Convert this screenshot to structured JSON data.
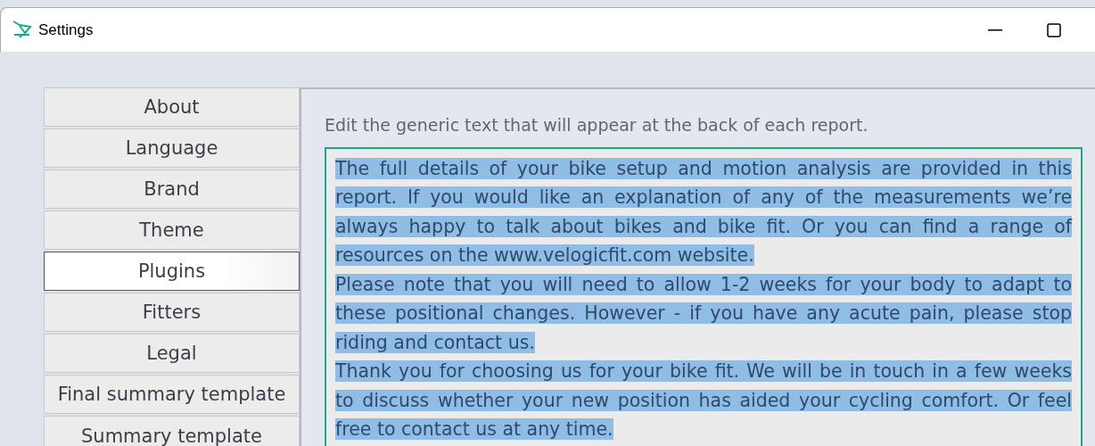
{
  "window": {
    "title": "Settings"
  },
  "sidebar": {
    "items": [
      {
        "label": "About",
        "selected": false
      },
      {
        "label": "Language",
        "selected": false
      },
      {
        "label": "Brand",
        "selected": false
      },
      {
        "label": "Theme",
        "selected": false
      },
      {
        "label": "Plugins",
        "selected": true
      },
      {
        "label": "Fitters",
        "selected": false
      },
      {
        "label": "Legal",
        "selected": false
      },
      {
        "label": "Final summary template",
        "selected": false
      },
      {
        "label": "Summary template",
        "selected": false
      }
    ]
  },
  "panel": {
    "instruction": "Edit the generic text that will appear at the back of each report.",
    "editor": {
      "text_selected": true,
      "paragraphs": [
        "The full details of your bike setup and motion analysis are provided in this report. If you would like an explanation of any of the measurements we’re always happy to talk about bikes and bike fit. Or you can find a range of resources on the www.velogicfit.com website.",
        "Please note that you will need to allow 1-2 weeks for your body to adapt to these positional changes. However - if you have any acute pain, please stop riding and contact us.",
        "Thank you for choosing us for your bike fit. We will be in touch in a few weeks to discuss whether your new position has aided your cycling comfort. Or feel free to contact us at any time."
      ]
    }
  }
}
